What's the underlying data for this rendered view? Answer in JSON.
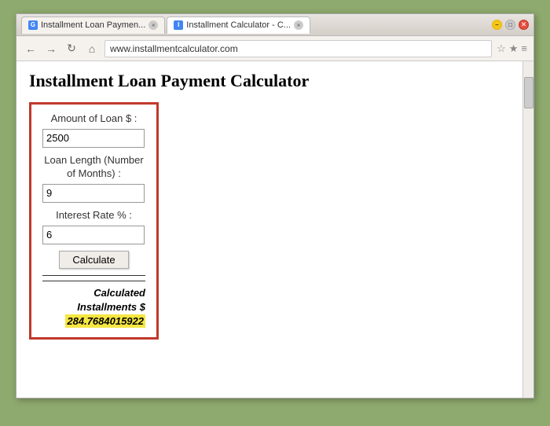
{
  "browser": {
    "tabs": [
      {
        "label": "Installment Loan Paymen...",
        "active": false,
        "favicon": "G"
      },
      {
        "label": "Installment Calculator - C...",
        "active": true,
        "favicon": "I"
      }
    ],
    "address": "www.installmentcalculator.com",
    "nav": {
      "back": "←",
      "forward": "→",
      "refresh": "↻",
      "home": "⌂"
    },
    "window_controls": {
      "minimize": "−",
      "maximize": "□",
      "close": "✕"
    }
  },
  "page": {
    "title": "Installment Loan Payment Calculator",
    "calculator": {
      "amount_label": "Amount of Loan $ :",
      "amount_value": "2500",
      "length_label": "Loan Length (Number of Months) :",
      "length_value": "9",
      "interest_label": "Interest Rate % :",
      "interest_value": "6",
      "calculate_button": "Calculate",
      "result_label": "Calculated Installments $",
      "result_value": "284.7684015922"
    }
  }
}
